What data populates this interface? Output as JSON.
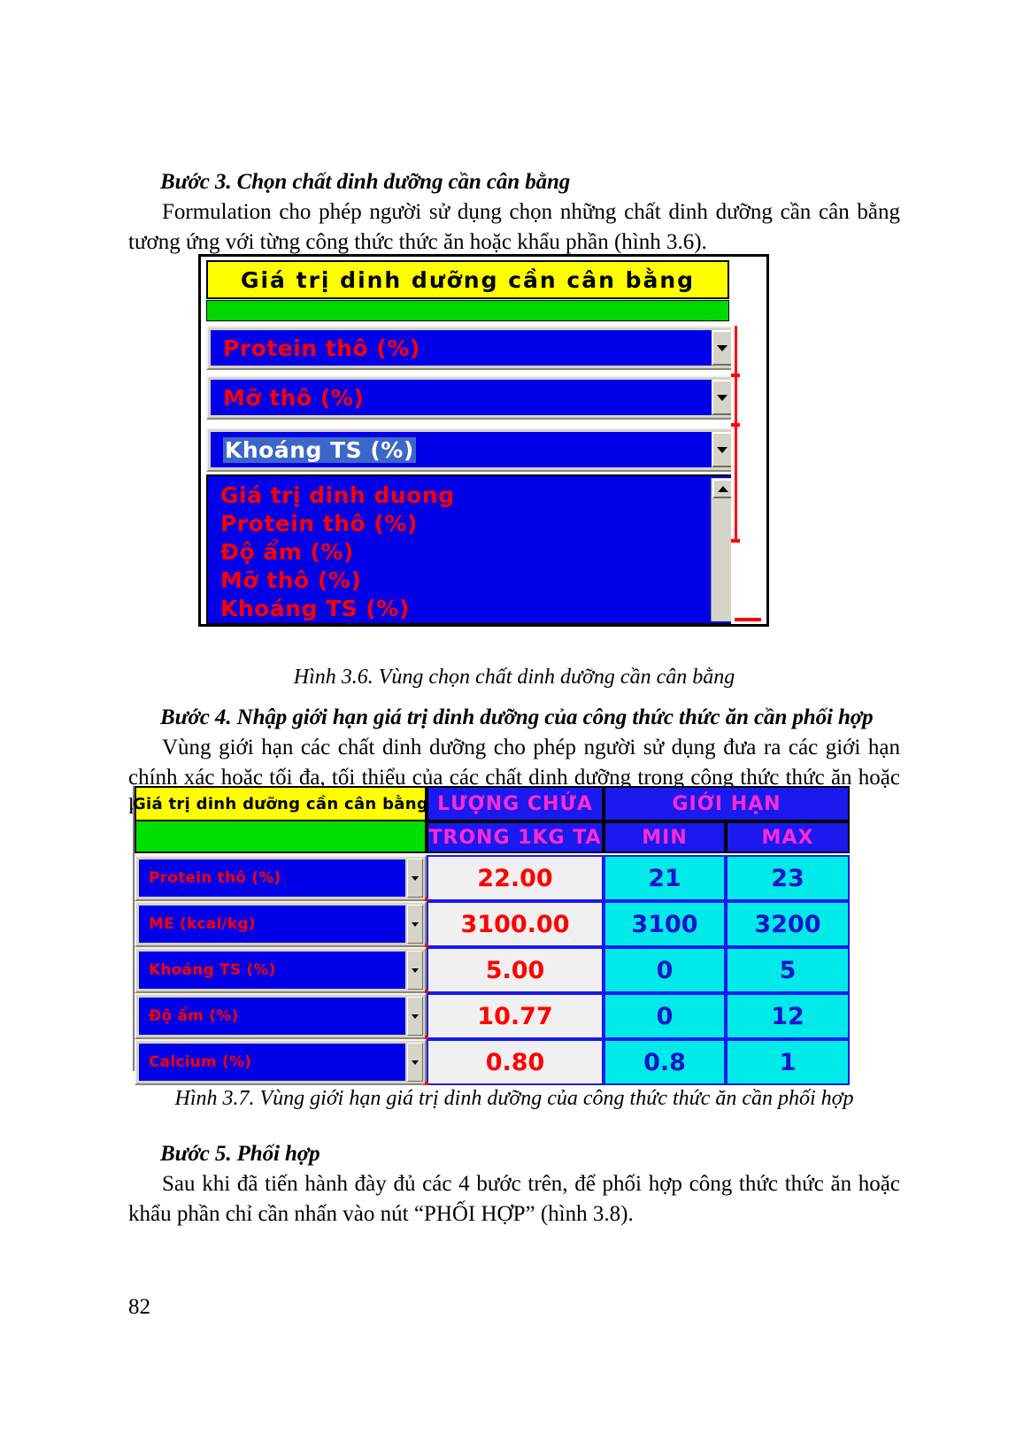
{
  "document": {
    "page_number": "82",
    "section_3": {
      "heading": "Bước 3. Chọn chất dinh dưỡng cần cân bằng",
      "paragraph": "Formulation cho phép người sử dụng chọn những chất dinh dưỡng cần cân bằng tương ứng với từng công thức thức ăn hoặc khẩu phần (hình 3.6)."
    },
    "section_4": {
      "heading": "Bước 4. Nhập giới hạn giá trị dinh dưỡng của công thức thức ăn cần phối hợp",
      "paragraph": "Vùng giới hạn các chất dinh dưỡng cho phép người sử dụng đưa ra các giới hạn chính xác hoặc tối đa, tối thiểu của các chất dinh dưỡng trong công thức thức ăn hoặc khẩu phần cần phối hợp."
    },
    "section_5": {
      "heading": "Bước 5. Phối hợp",
      "paragraph": "Sau khi đã tiến hành đày đủ các 4 bước trên, để phối hợp công thức thức ăn hoặc khẩu phần chỉ cần nhấn vào nút “PHỐI HỢP” (hình 3.8)."
    },
    "figure_3_6": {
      "caption": "Hình 3.6. Vùng chọn chất dinh dưỡng cần cân bằng",
      "title_bar": "Giá trị dinh dưỡng cần cân bằng",
      "combos": [
        {
          "value": "Protein thô (%)",
          "selected": false
        },
        {
          "value": "Mỡ thô (%)",
          "selected": false
        },
        {
          "value": "Khoáng TS (%)",
          "selected": true
        }
      ],
      "dropdown_options": [
        "Giá trị dinh duong",
        "Protein thô (%)",
        "Độ ẩm (%)",
        "Mỡ thô (%)",
        "Khoáng TS (%)"
      ],
      "colors": {
        "title_bg": "#ffff00",
        "band_bg": "#00d900",
        "field_bg": "#0000e8",
        "field_text": "#ff0000",
        "selected_text": "#ffffff"
      }
    },
    "figure_3_7": {
      "caption": "Hình 3.7. Vùng giới hạn giá trị dinh dưỡng của công thức thức ăn cần phối hợp",
      "headers": {
        "col1_top": "Giá trị dinh dưỡng cần cân bằng",
        "col1_bottom": "",
        "col2_top": "LƯỢNG CHỨA",
        "col2_bottom": "TRONG 1KG TA",
        "col34_top": "GIỚI HẠN",
        "col3_bottom": "MIN",
        "col4_bottom": "MAX"
      },
      "rows": [
        {
          "nutrient": "Protein thô (%)",
          "amount": "22.00",
          "min": "21",
          "max": "23"
        },
        {
          "nutrient": "ME (kcal/kg)",
          "amount": "3100.00",
          "min": "3100",
          "max": "3200"
        },
        {
          "nutrient": "Khoáng TS (%)",
          "amount": "5.00",
          "min": "0",
          "max": "5"
        },
        {
          "nutrient": "Độ ẩm (%)",
          "amount": "10.77",
          "min": "0",
          "max": "12"
        },
        {
          "nutrient": "Calcium (%)",
          "amount": "0.80",
          "min": "0.8",
          "max": "1"
        }
      ],
      "colors": {
        "header_yellow": "#ffff00",
        "header_blue": "#1a1aee",
        "header_magenta": "#ff2bd0",
        "green_band": "#00e000",
        "amount_text": "#ff0000",
        "limit_bg": "#00eaea",
        "limit_text": "#1414c8"
      }
    }
  }
}
